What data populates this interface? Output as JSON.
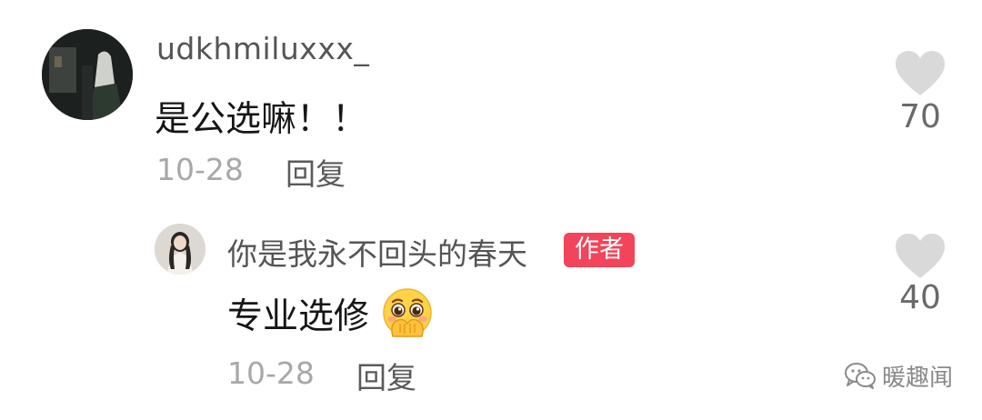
{
  "comment": {
    "username": "udkhmiluxxx_",
    "text": "是公选嘛！！",
    "date": "10-28",
    "reply_label": "回复",
    "likes": "70",
    "like_icon": "heart-icon"
  },
  "reply": {
    "username": "你是我永不回头的春天",
    "badge": "作者",
    "text": "专业选修",
    "emoji_icon": "pleading-face-emoji",
    "date": "10-28",
    "reply_label": "回复",
    "likes": "40",
    "like_icon": "heart-icon"
  },
  "watermark": {
    "text": "暖趣闻",
    "icon": "wechat-icon"
  },
  "colors": {
    "badge_bg": "#f2445a",
    "heart": "#d9d9d9",
    "meta_text": "#a8a8a8"
  }
}
